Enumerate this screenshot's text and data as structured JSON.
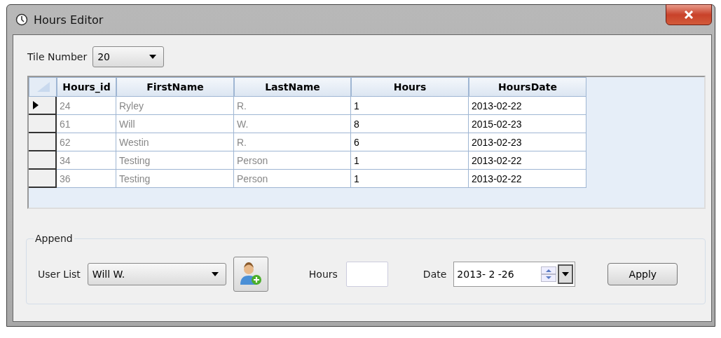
{
  "window": {
    "title": "Hours Editor"
  },
  "tile": {
    "label": "Tile Number",
    "value": "20"
  },
  "table": {
    "columns": [
      {
        "label": "Hours_id",
        "kind": "readonly"
      },
      {
        "label": "FirstName",
        "kind": "readonly"
      },
      {
        "label": "LastName",
        "kind": "readonly"
      },
      {
        "label": "Hours",
        "kind": "editable"
      },
      {
        "label": "HoursDate",
        "kind": "editable"
      }
    ],
    "rows": [
      {
        "selected": true,
        "cells": [
          "24",
          "Ryley",
          "R.",
          "1",
          "2013-02-22"
        ]
      },
      {
        "selected": false,
        "cells": [
          "61",
          "Will",
          "W.",
          "8",
          "2015-02-23"
        ]
      },
      {
        "selected": false,
        "cells": [
          "62",
          "Westin",
          "R.",
          "6",
          "2013-02-23"
        ]
      },
      {
        "selected": false,
        "cells": [
          "34",
          "Testing",
          "Person",
          "1",
          "2013-02-22"
        ]
      },
      {
        "selected": false,
        "cells": [
          "36",
          "Testing",
          "Person",
          "1",
          "2013-02-22"
        ]
      }
    ]
  },
  "append": {
    "title": "Append",
    "user_list_label": "User List",
    "user_list_value": "Will W.",
    "hours_label": "Hours",
    "date_label": "Date",
    "date_value": "2013- 2 -26",
    "apply": "Apply"
  }
}
